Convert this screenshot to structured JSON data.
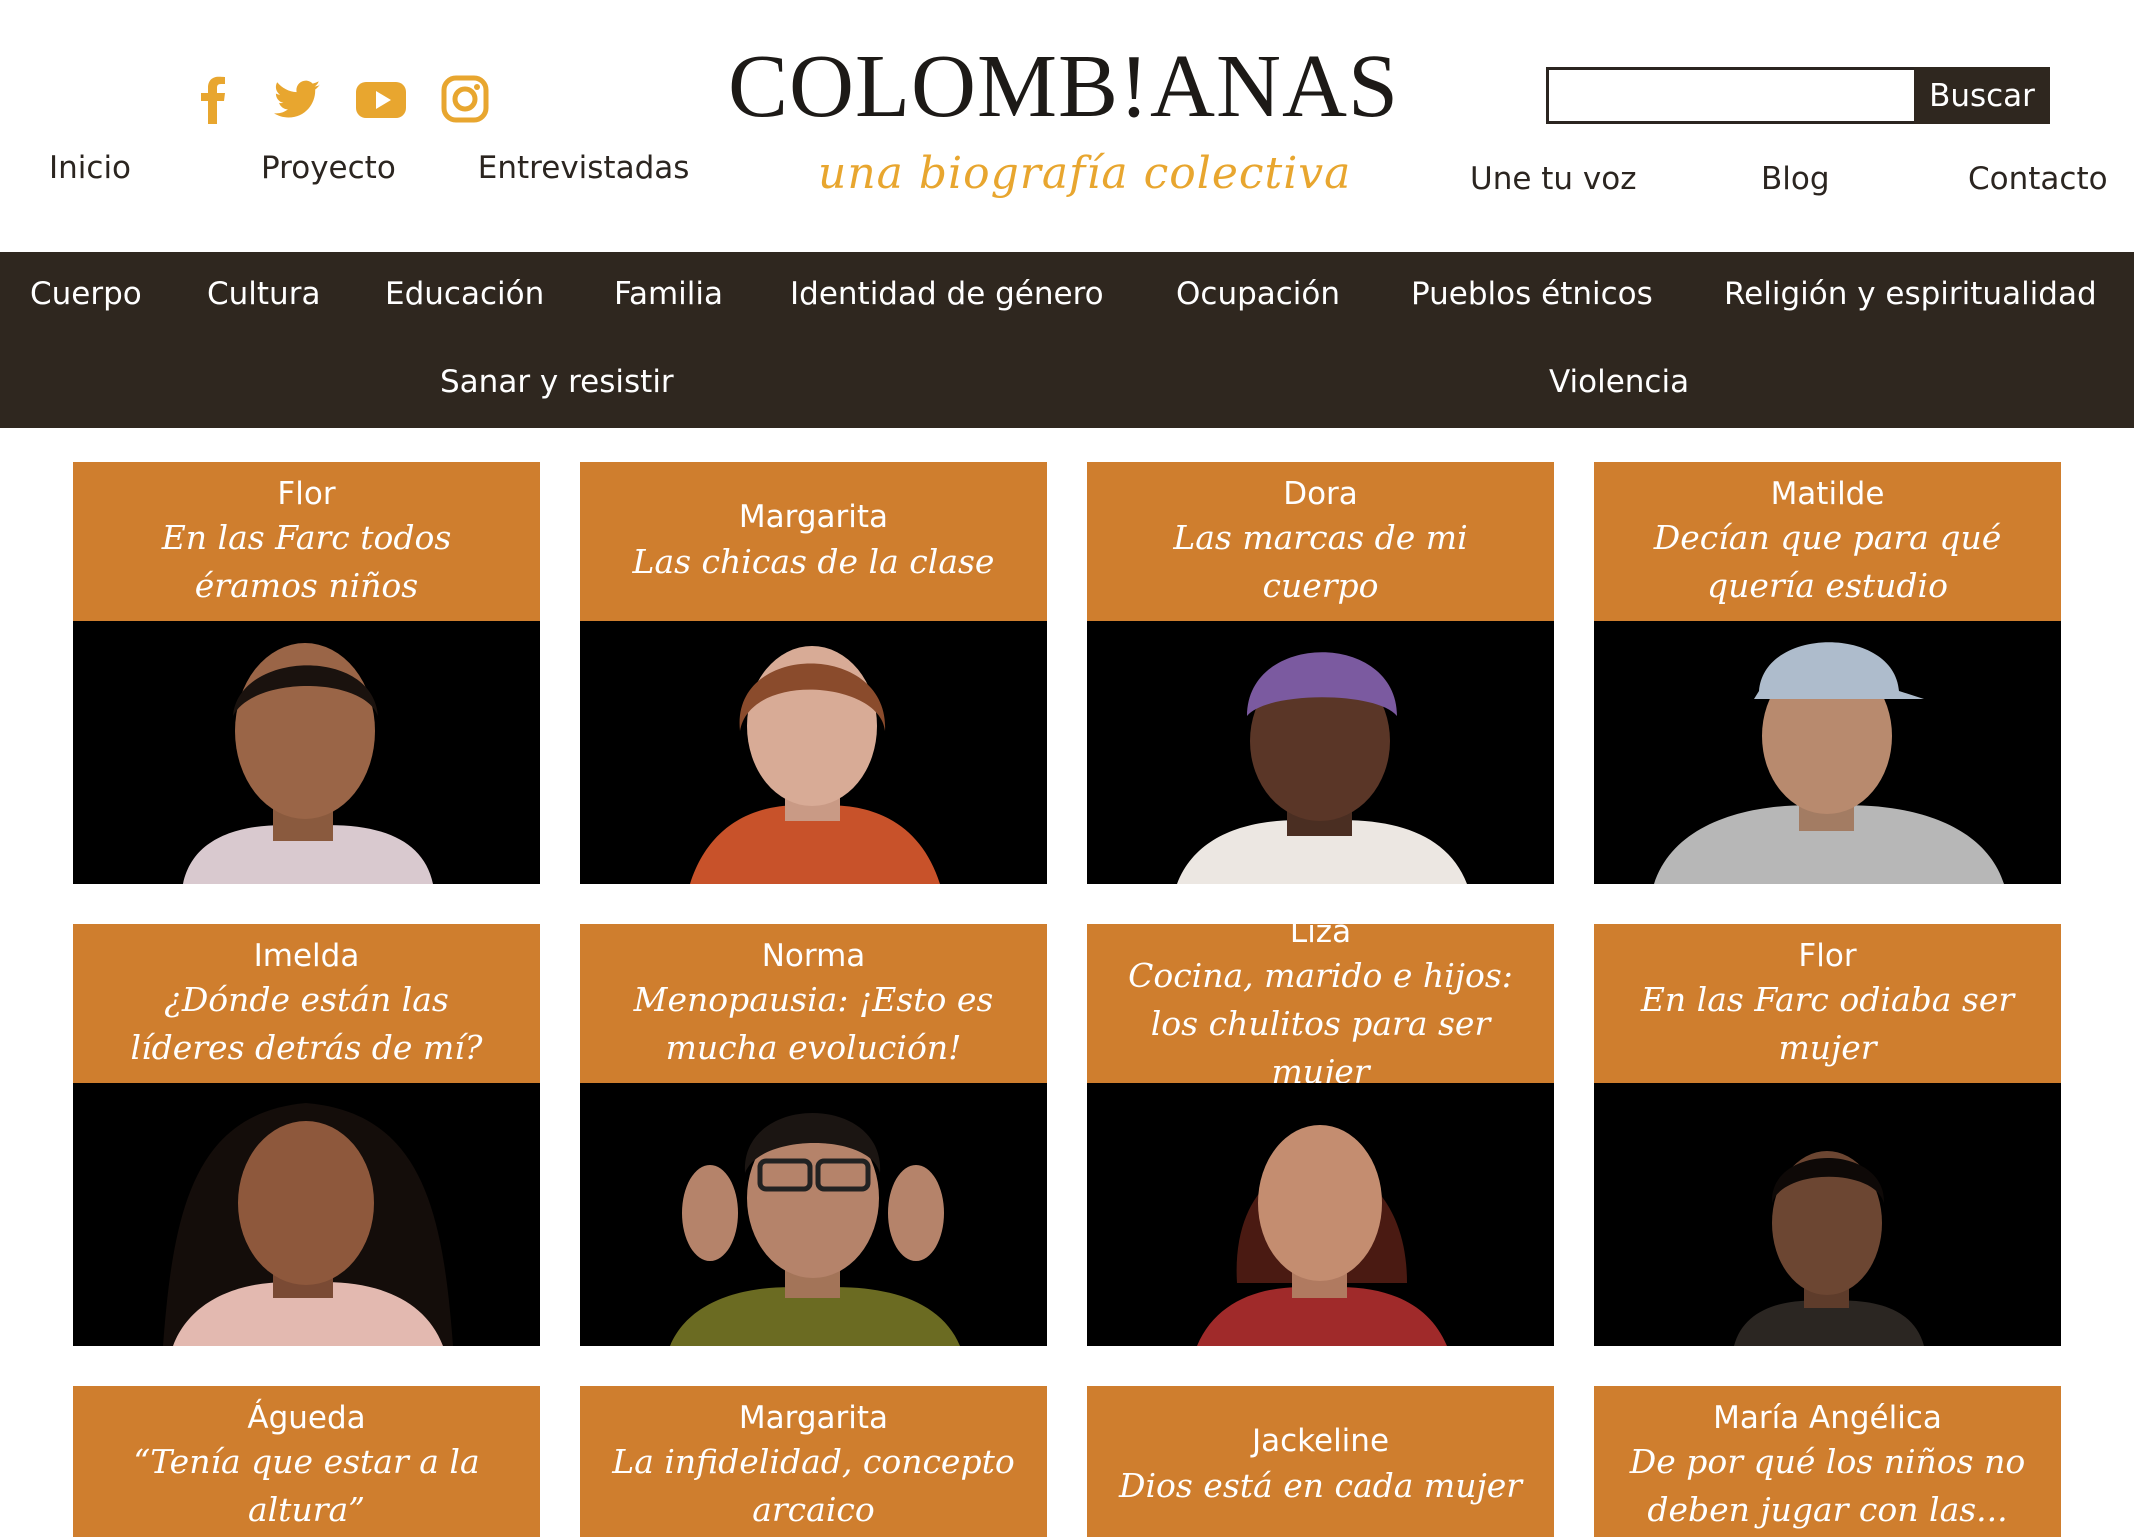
{
  "brand": {
    "logo_text": "COLOMB!ANAS",
    "tagline": "una biografía colectiva",
    "accent_color": "#e8a62f",
    "dark_color": "#2f271f",
    "card_color": "#cf7e2e"
  },
  "social": [
    {
      "icon": "facebook-icon"
    },
    {
      "icon": "twitter-icon"
    },
    {
      "icon": "youtube-icon"
    },
    {
      "icon": "instagram-icon"
    }
  ],
  "nav_left": [
    "Inicio",
    "Proyecto",
    "Entrevistadas"
  ],
  "nav_right": [
    "Une tu voz",
    "Blog",
    "Contacto"
  ],
  "search": {
    "value": "",
    "button_label": "Buscar"
  },
  "categories": [
    "Cuerpo",
    "Cultura",
    "Educación",
    "Familia",
    "Identidad de género",
    "Ocupación",
    "Pueblos étnicos",
    "Religión y espiritualidad",
    "Sanar y resistir",
    "Violencia"
  ],
  "cards": [
    {
      "name": "Flor",
      "quote": "En las Farc todos éramos niños"
    },
    {
      "name": "Margarita",
      "quote": "Las chicas de la clase"
    },
    {
      "name": "Dora",
      "quote": "Las marcas de mi cuerpo"
    },
    {
      "name": "Matilde",
      "quote": "Decían que para qué quería estudio"
    },
    {
      "name": "Imelda",
      "quote": "¿Dónde están las líderes detrás de mí?"
    },
    {
      "name": "Norma",
      "quote": "Menopausia: ¡Esto es mucha evolución!"
    },
    {
      "name": "Liza",
      "quote": "Cocina, marido e hijos: los chulitos para ser mujer"
    },
    {
      "name": "Flor",
      "quote": "En las Farc odiaba ser mujer"
    },
    {
      "name": "Águeda",
      "quote": "“Tenía que estar a la altura”"
    },
    {
      "name": "Margarita",
      "quote": "La infidelidad, concepto arcaico"
    },
    {
      "name": "Jackeline",
      "quote": "Dios está en cada mujer"
    },
    {
      "name": "María Angélica",
      "quote": "De por qué los niños no deben jugar con las..."
    }
  ]
}
